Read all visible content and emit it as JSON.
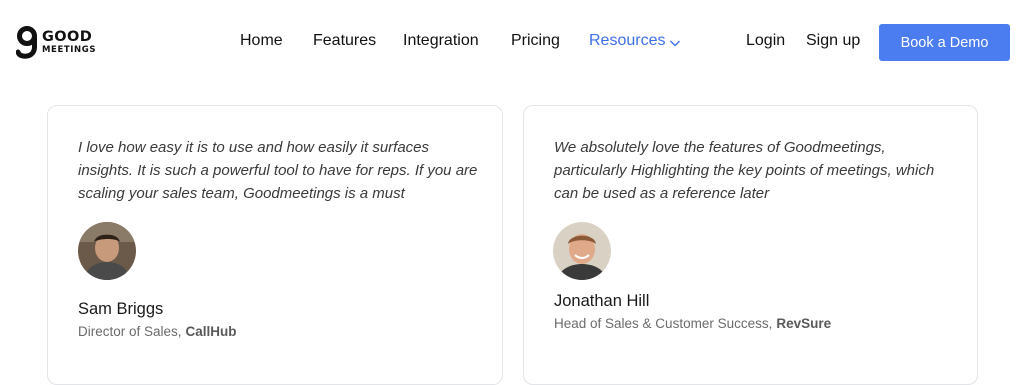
{
  "brand": {
    "line1": "GOOD",
    "line2": "MEETINGS",
    "accent_color": "#4b7cf0"
  },
  "nav": {
    "links": [
      {
        "label": "Home"
      },
      {
        "label": "Features"
      },
      {
        "label": "Integration"
      },
      {
        "label": "Pricing"
      },
      {
        "label": "Resources",
        "active": true,
        "icon": "chevron-down-icon"
      }
    ],
    "login": "Login",
    "signup": "Sign up",
    "cta": "Book a Demo"
  },
  "testimonials": [
    {
      "quote": "I love how easy it is to use and how easily it surfaces insights. It is such a powerful tool to have for reps. If you are scaling your sales team, Goodmeetings is a must",
      "name": "Sam Briggs",
      "title": "Director of Sales,",
      "company": "CallHub"
    },
    {
      "quote": "We absolutely love the features of Goodmeetings, particularly Highlighting the key points of meetings, which can be used as a reference later",
      "name": "Jonathan Hill",
      "title": "Head of Sales & Customer Success,",
      "company": "RevSure"
    }
  ]
}
